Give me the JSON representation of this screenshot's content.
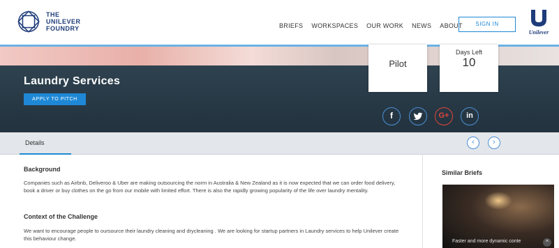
{
  "header": {
    "logo_lines": [
      "THE",
      "UNILEVER",
      "FOUNDRY"
    ],
    "nav": [
      "BRIEFS",
      "WORKSPACES",
      "OUR WORK",
      "NEWS",
      "ABOUT"
    ],
    "signin_label": "SIGN IN",
    "brand_word": "Unilever"
  },
  "hero": {
    "title": "Laundry Services",
    "apply_label": "APPLY TO PITCH",
    "stage_label": "Pilot",
    "days_left_label": "Days Left",
    "days_left_value": "10",
    "social": {
      "facebook": "f",
      "twitter": "t",
      "googleplus": "G+",
      "linkedin": "in"
    }
  },
  "tabs": {
    "details_label": "Details",
    "prev_glyph": "‹",
    "next_glyph": "›"
  },
  "content": {
    "background_heading": "Background",
    "background_text": "Companies such as Airbnb, Deliveroo & Uber are making outsourcing the norm in Australia & New Zealand as it is now expected that we can order food delivery, book a driver or buy clothes on the go from our mobile with limited effort. There is also the rapidly growing popularity of the life over laundry mentality.",
    "context_heading": "Context of the Challenge",
    "context_text": "We want to encourage people to oursource their laundry cleaning and drycleaning . We are looking for startup partners in Laundry services to help Unilever create this behaviour change."
  },
  "sidebar": {
    "heading": "Similar Briefs",
    "card_caption": "Faster and more dynamic conte"
  },
  "colors": {
    "accent": "#1e88d6",
    "hero_dark": "#2a3b47",
    "brand_blue": "#1f3c7a"
  }
}
